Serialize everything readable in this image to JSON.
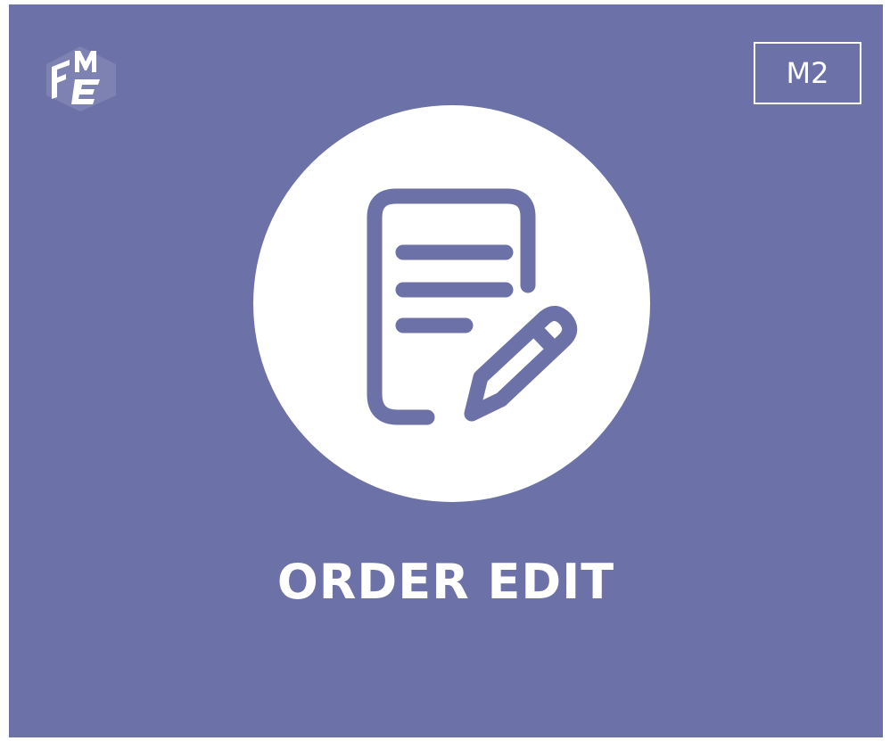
{
  "banner": {
    "title": "ORDER EDIT",
    "badge": "M2",
    "logo_text": "FME",
    "icon": "document-edit-icon"
  },
  "colors": {
    "background": "#6c71a8",
    "foreground": "#ffffff"
  }
}
